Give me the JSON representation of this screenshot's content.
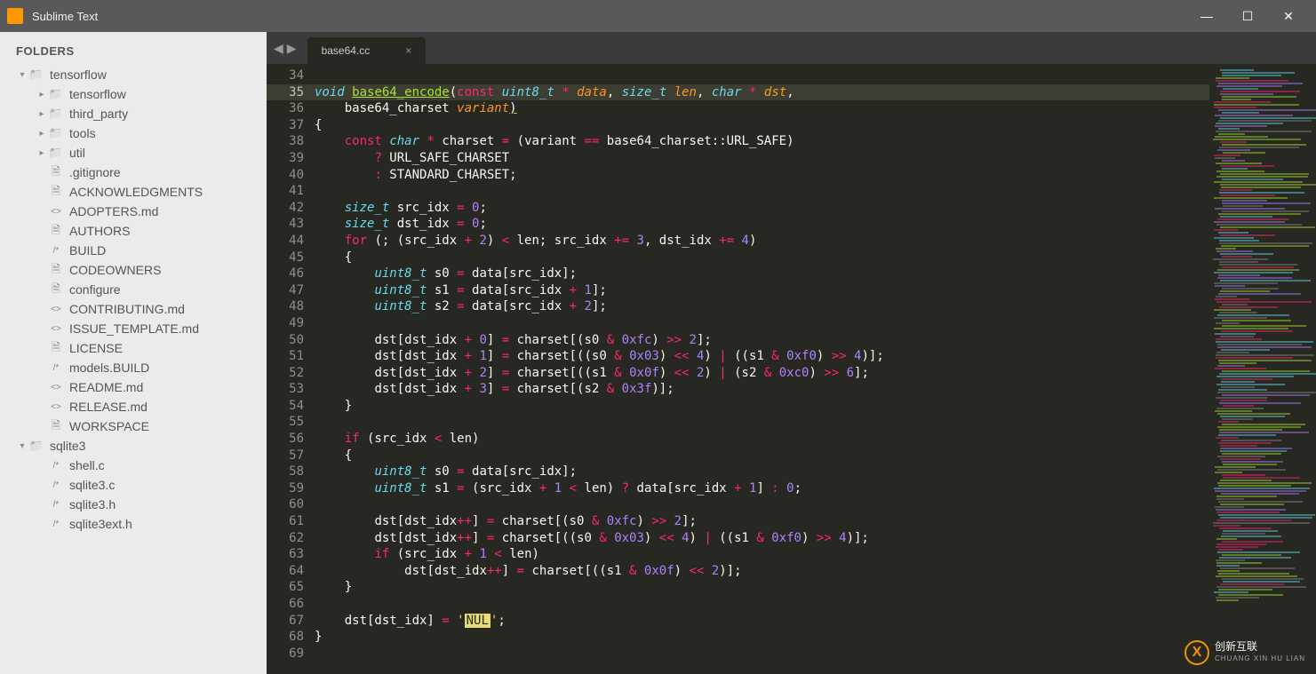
{
  "window": {
    "title": "Sublime Text"
  },
  "sidebar": {
    "heading": "FOLDERS",
    "tree": [
      {
        "type": "folder",
        "depth": 0,
        "open": true,
        "name": "tensorflow",
        "icon": "folder"
      },
      {
        "type": "folder",
        "depth": 1,
        "open": false,
        "name": "tensorflow",
        "icon": "folder"
      },
      {
        "type": "folder",
        "depth": 1,
        "open": false,
        "name": "third_party",
        "icon": "folder"
      },
      {
        "type": "folder",
        "depth": 1,
        "open": false,
        "name": "tools",
        "icon": "folder"
      },
      {
        "type": "folder",
        "depth": 1,
        "open": false,
        "name": "util",
        "icon": "folder"
      },
      {
        "type": "file",
        "depth": 1,
        "name": ".gitignore",
        "icon": "file"
      },
      {
        "type": "file",
        "depth": 1,
        "name": "ACKNOWLEDGMENTS",
        "icon": "file"
      },
      {
        "type": "file",
        "depth": 1,
        "name": "ADOPTERS.md",
        "icon": "md"
      },
      {
        "type": "file",
        "depth": 1,
        "name": "AUTHORS",
        "icon": "file"
      },
      {
        "type": "file",
        "depth": 1,
        "name": "BUILD",
        "icon": "build"
      },
      {
        "type": "file",
        "depth": 1,
        "name": "CODEOWNERS",
        "icon": "file"
      },
      {
        "type": "file",
        "depth": 1,
        "name": "configure",
        "icon": "file"
      },
      {
        "type": "file",
        "depth": 1,
        "name": "CONTRIBUTING.md",
        "icon": "md"
      },
      {
        "type": "file",
        "depth": 1,
        "name": "ISSUE_TEMPLATE.md",
        "icon": "md"
      },
      {
        "type": "file",
        "depth": 1,
        "name": "LICENSE",
        "icon": "file"
      },
      {
        "type": "file",
        "depth": 1,
        "name": "models.BUILD",
        "icon": "build"
      },
      {
        "type": "file",
        "depth": 1,
        "name": "README.md",
        "icon": "md"
      },
      {
        "type": "file",
        "depth": 1,
        "name": "RELEASE.md",
        "icon": "md"
      },
      {
        "type": "file",
        "depth": 1,
        "name": "WORKSPACE",
        "icon": "file"
      },
      {
        "type": "folder",
        "depth": 0,
        "open": true,
        "name": "sqlite3",
        "icon": "folder"
      },
      {
        "type": "file",
        "depth": 1,
        "name": "shell.c",
        "icon": "build"
      },
      {
        "type": "file",
        "depth": 1,
        "name": "sqlite3.c",
        "icon": "build"
      },
      {
        "type": "file",
        "depth": 1,
        "name": "sqlite3.h",
        "icon": "build"
      },
      {
        "type": "file",
        "depth": 1,
        "name": "sqlite3ext.h",
        "icon": "build"
      }
    ]
  },
  "tabs": [
    {
      "label": "base64.cc",
      "active": true
    }
  ],
  "editor": {
    "first_line": 34,
    "active_line": 35,
    "lines": [
      {
        "n": 34,
        "html": ""
      },
      {
        "n": 35,
        "html": "<span class='kw-type'>void</span> <span class='fn ul'>base64_encode</span><span class='txt'>(</span><span class='kw'>const</span> <span class='kw-type'>uint8_t</span> <span class='kw'>*</span> <span class='param'>data</span><span class='txt'>,</span> <span class='kw-type'>size_t</span> <span class='param'>len</span><span class='txt'>,</span> <span class='kw-type'>char</span> <span class='kw'>*</span> <span class='param'>dst</span><span class='txt'>,</span>"
      },
      {
        "n": 36,
        "html": "    <span class='txt'>base64_charset </span><span class='param'>variant</span><span class='txt ul'>)</span>"
      },
      {
        "n": 37,
        "html": "<span class='txt'>{</span>"
      },
      {
        "n": 38,
        "html": "    <span class='kw'>const</span> <span class='kw-type'>char</span> <span class='kw'>*</span> <span class='txt'>charset </span><span class='kw'>=</span><span class='txt'> (variant </span><span class='kw'>==</span><span class='txt'> base64_charset::URL_SAFE)</span>"
      },
      {
        "n": 39,
        "html": "        <span class='kw'>?</span><span class='txt'> URL_SAFE_CHARSET</span>"
      },
      {
        "n": 40,
        "html": "        <span class='kw'>:</span><span class='txt'> STANDARD_CHARSET;</span>"
      },
      {
        "n": 41,
        "html": ""
      },
      {
        "n": 42,
        "html": "    <span class='kw-type'>size_t</span><span class='txt'> src_idx </span><span class='kw'>=</span> <span class='num'>0</span><span class='txt'>;</span>"
      },
      {
        "n": 43,
        "html": "    <span class='kw-type'>size_t</span><span class='txt'> dst_idx </span><span class='kw'>=</span> <span class='num'>0</span><span class='txt'>;</span>"
      },
      {
        "n": 44,
        "html": "    <span class='kw'>for</span><span class='txt'> (; (src_idx </span><span class='kw'>+</span> <span class='num'>2</span><span class='txt'>) </span><span class='kw'>&lt;</span><span class='txt'> len; src_idx </span><span class='kw'>+=</span> <span class='num'>3</span><span class='txt'>, dst_idx </span><span class='kw'>+=</span> <span class='num'>4</span><span class='txt'>)</span>"
      },
      {
        "n": 45,
        "html": "    <span class='txt'>{</span>"
      },
      {
        "n": 46,
        "html": "        <span class='kw-type'>uint8_t</span><span class='txt'> s0 </span><span class='kw'>=</span><span class='txt'> data[src_idx];</span>"
      },
      {
        "n": 47,
        "html": "        <span class='kw-type'>uint8_t</span><span class='txt'> s1 </span><span class='kw'>=</span><span class='txt'> data[src_idx </span><span class='kw'>+</span> <span class='num'>1</span><span class='txt'>];</span>"
      },
      {
        "n": 48,
        "html": "        <span class='kw-type'>uint8_t</span><span class='txt'> s2 </span><span class='kw'>=</span><span class='txt'> data[src_idx </span><span class='kw'>+</span> <span class='num'>2</span><span class='txt'>];</span>"
      },
      {
        "n": 49,
        "html": ""
      },
      {
        "n": 50,
        "html": "        <span class='txt'>dst[dst_idx </span><span class='kw'>+</span> <span class='num'>0</span><span class='txt'>] </span><span class='kw'>=</span><span class='txt'> charset[(s0 </span><span class='kw'>&amp;</span> <span class='num'>0xfc</span><span class='txt'>) </span><span class='kw'>&gt;&gt;</span> <span class='num'>2</span><span class='txt'>];</span>"
      },
      {
        "n": 51,
        "html": "        <span class='txt'>dst[dst_idx </span><span class='kw'>+</span> <span class='num'>1</span><span class='txt'>] </span><span class='kw'>=</span><span class='txt'> charset[((s0 </span><span class='kw'>&amp;</span> <span class='num'>0x03</span><span class='txt'>) </span><span class='kw'>&lt;&lt;</span> <span class='num'>4</span><span class='txt'>) </span><span class='kw'>|</span><span class='txt'> ((s1 </span><span class='kw'>&amp;</span> <span class='num'>0xf0</span><span class='txt'>) </span><span class='kw'>&gt;&gt;</span> <span class='num'>4</span><span class='txt'>)];</span>"
      },
      {
        "n": 52,
        "html": "        <span class='txt'>dst[dst_idx </span><span class='kw'>+</span> <span class='num'>2</span><span class='txt'>] </span><span class='kw'>=</span><span class='txt'> charset[((s1 </span><span class='kw'>&amp;</span> <span class='num'>0x0f</span><span class='txt'>) </span><span class='kw'>&lt;&lt;</span> <span class='num'>2</span><span class='txt'>) </span><span class='kw'>|</span><span class='txt'> (s2 </span><span class='kw'>&amp;</span> <span class='num'>0xc0</span><span class='txt'>) </span><span class='kw'>&gt;&gt;</span> <span class='num'>6</span><span class='txt'>];</span>"
      },
      {
        "n": 53,
        "html": "        <span class='txt'>dst[dst_idx </span><span class='kw'>+</span> <span class='num'>3</span><span class='txt'>] </span><span class='kw'>=</span><span class='txt'> charset[(s2 </span><span class='kw'>&amp;</span> <span class='num'>0x3f</span><span class='txt'>)];</span>"
      },
      {
        "n": 54,
        "html": "    <span class='txt'>}</span>"
      },
      {
        "n": 55,
        "html": ""
      },
      {
        "n": 56,
        "html": "    <span class='kw'>if</span><span class='txt'> (src_idx </span><span class='kw'>&lt;</span><span class='txt'> len)</span>"
      },
      {
        "n": 57,
        "html": "    <span class='txt'>{</span>"
      },
      {
        "n": 58,
        "html": "        <span class='kw-type'>uint8_t</span><span class='txt'> s0 </span><span class='kw'>=</span><span class='txt'> data[src_idx];</span>"
      },
      {
        "n": 59,
        "html": "        <span class='kw-type'>uint8_t</span><span class='txt'> s1 </span><span class='kw'>=</span><span class='txt'> (src_idx </span><span class='kw'>+</span> <span class='num'>1</span> <span class='kw'>&lt;</span><span class='txt'> len) </span><span class='kw'>?</span><span class='txt'> data[src_idx </span><span class='kw'>+</span> <span class='num'>1</span><span class='txt'>] </span><span class='kw'>:</span> <span class='num'>0</span><span class='txt'>;</span>"
      },
      {
        "n": 60,
        "html": ""
      },
      {
        "n": 61,
        "html": "        <span class='txt'>dst[dst_idx</span><span class='kw'>++</span><span class='txt'>] </span><span class='kw'>=</span><span class='txt'> charset[(s0 </span><span class='kw'>&amp;</span> <span class='num'>0xfc</span><span class='txt'>) </span><span class='kw'>&gt;&gt;</span> <span class='num'>2</span><span class='txt'>];</span>"
      },
      {
        "n": 62,
        "html": "        <span class='txt'>dst[dst_idx</span><span class='kw'>++</span><span class='txt'>] </span><span class='kw'>=</span><span class='txt'> charset[((s0 </span><span class='kw'>&amp;</span> <span class='num'>0x03</span><span class='txt'>) </span><span class='kw'>&lt;&lt;</span> <span class='num'>4</span><span class='txt'>) </span><span class='kw'>|</span><span class='txt'> ((s1 </span><span class='kw'>&amp;</span> <span class='num'>0xf0</span><span class='txt'>) </span><span class='kw'>&gt;&gt;</span> <span class='num'>4</span><span class='txt'>)];</span>"
      },
      {
        "n": 63,
        "html": "        <span class='kw'>if</span><span class='txt'> (src_idx </span><span class='kw'>+</span> <span class='num'>1</span> <span class='kw'>&lt;</span><span class='txt'> len)</span>"
      },
      {
        "n": 64,
        "html": "            <span class='txt'>dst[dst_idx</span><span class='kw'>++</span><span class='txt'>] </span><span class='kw'>=</span><span class='txt'> charset[((s1 </span><span class='kw'>&amp;</span> <span class='num'>0x0f</span><span class='txt'>) </span><span class='kw'>&lt;&lt;</span> <span class='num'>2</span><span class='txt'>)];</span>"
      },
      {
        "n": 65,
        "html": "    <span class='txt'>}</span>"
      },
      {
        "n": 66,
        "html": ""
      },
      {
        "n": 67,
        "html": "    <span class='txt'>dst[dst_idx] </span><span class='kw'>=</span> <span class='str'>'</span><span class='nul'>NUL</span><span class='str'>'</span><span class='txt'>;</span>"
      },
      {
        "n": 68,
        "html": "<span class='txt'>}</span>"
      },
      {
        "n": 69,
        "html": ""
      }
    ]
  },
  "watermark": {
    "brand": "创新互联",
    "sub": "CHUANG XIN HU LIAN"
  }
}
